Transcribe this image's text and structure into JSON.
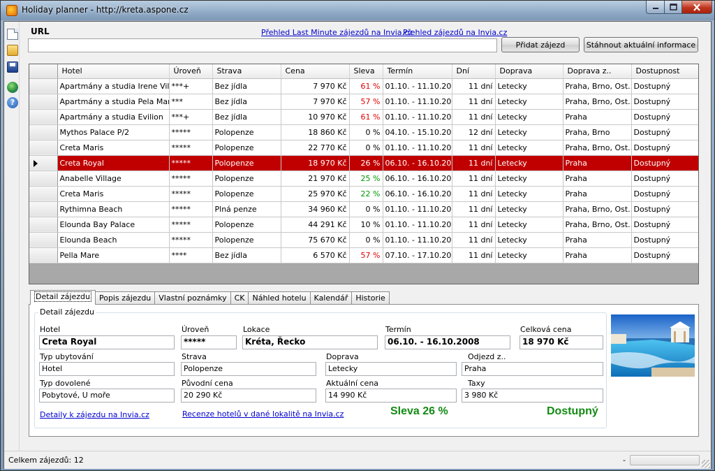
{
  "window": {
    "title": "Holiday planner - http://kreta.aspone.cz"
  },
  "url_section": {
    "label": "URL",
    "value": "",
    "link_last_minute": "Přehled Last Minute zájezdů na Invia.cz",
    "link_overview": "Přehled zájezdů na Invia.cz",
    "add_button": "Přidat zájezd",
    "download_button": "Stáhnout aktuální informace"
  },
  "grid": {
    "columns": [
      "Hotel",
      "Úroveň",
      "Strava",
      "Cena",
      "Sleva",
      "Termín",
      "Dní",
      "Doprava",
      "Doprava z..",
      "Dostupnost"
    ],
    "rows": [
      {
        "hotel": "Apartmány a studia Irene Village",
        "level": "***+",
        "board": "Bez jídla",
        "price": "7 970 Kč",
        "discount": "61 %",
        "discount_color": "red",
        "term": "01.10. - 11.10.20...",
        "days": "11 dní",
        "transport": "Letecky",
        "from": "Praha, Brno, Ost...",
        "availability": "Dostupný"
      },
      {
        "hotel": "Apartmány a studia Pela Mare",
        "level": "***",
        "board": "Bez jídla",
        "price": "7 970 Kč",
        "discount": "57 %",
        "discount_color": "red",
        "term": "01.10. - 11.10.20...",
        "days": "11 dní",
        "transport": "Letecky",
        "from": "Praha, Brno, Ost...",
        "availability": "Dostupný"
      },
      {
        "hotel": "Apartmány a studia Evilion",
        "level": "***+",
        "board": "Bez jídla",
        "price": "10 970 Kč",
        "discount": "61 %",
        "discount_color": "red",
        "term": "01.10. - 11.10.20...",
        "days": "11 dní",
        "transport": "Letecky",
        "from": "Praha",
        "availability": "Dostupný"
      },
      {
        "hotel": "Mythos Palace P/2",
        "level": "*****",
        "board": "Polopenze",
        "price": "18 860 Kč",
        "discount": "0 %",
        "discount_color": "black",
        "term": "04.10. - 15.10.20...",
        "days": "12 dní",
        "transport": "Letecky",
        "from": "Praha, Brno",
        "availability": "Dostupný"
      },
      {
        "hotel": "Creta Maris",
        "level": "*****",
        "board": "Polopenze",
        "price": "22 770 Kč",
        "discount": "0 %",
        "discount_color": "black",
        "term": "01.10. - 11.10.20...",
        "days": "11 dní",
        "transport": "Letecky",
        "from": "Praha, Brno, Ost...",
        "availability": "Dostupný"
      },
      {
        "hotel": "Creta Royal",
        "level": "*****",
        "board": "Polopenze",
        "price": "18 970 Kč",
        "discount": "26 %",
        "discount_color": "black",
        "term": "06.10. - 16.10.20...",
        "days": "11 dní",
        "transport": "Letecky",
        "from": "Praha",
        "availability": "Dostupný",
        "selected": true
      },
      {
        "hotel": "Anabelle Village",
        "level": "*****",
        "board": "Polopenze",
        "price": "21 970 Kč",
        "discount": "25 %",
        "discount_color": "green",
        "term": "06.10. - 16.10.20...",
        "days": "11 dní",
        "transport": "Letecky",
        "from": "Praha",
        "availability": "Dostupný"
      },
      {
        "hotel": "Creta Maris",
        "level": "*****",
        "board": "Polopenze",
        "price": "25 970 Kč",
        "discount": "22 %",
        "discount_color": "green",
        "term": "06.10. - 16.10.20...",
        "days": "11 dní",
        "transport": "Letecky",
        "from": "Praha",
        "availability": "Dostupný"
      },
      {
        "hotel": "Rythimna Beach",
        "level": "*****",
        "board": "Plná penze",
        "price": "34 960 Kč",
        "discount": "0 %",
        "discount_color": "black",
        "term": "01.10. - 11.10.20...",
        "days": "11 dní",
        "transport": "Letecky",
        "from": "Praha, Brno, Ost...",
        "availability": "Dostupný"
      },
      {
        "hotel": "Elounda Bay Palace",
        "level": "*****",
        "board": "Polopenze",
        "price": "44 291 Kč",
        "discount": "10 %",
        "discount_color": "black",
        "term": "01.10. - 11.10.20...",
        "days": "11 dní",
        "transport": "Letecky",
        "from": "Praha, Brno, Ost...",
        "availability": "Dostupný"
      },
      {
        "hotel": "Elounda Beach",
        "level": "*****",
        "board": "Polopenze",
        "price": "75 670 Kč",
        "discount": "0 %",
        "discount_color": "black",
        "term": "01.10. - 11.10.20...",
        "days": "11 dní",
        "transport": "Letecky",
        "from": "Praha",
        "availability": "Dostupný"
      },
      {
        "hotel": "Pella Mare",
        "level": "****",
        "board": "Bez jídla",
        "price": "6 570 Kč",
        "discount": "57 %",
        "discount_color": "red",
        "term": "07.10. - 17.10.20...",
        "days": "11 dní",
        "transport": "Letecky",
        "from": "Praha",
        "availability": "Dostupný"
      }
    ]
  },
  "tabs": [
    "Detail zájezdu",
    "Popis zájezdu",
    "Vlastní poznámky",
    "CK",
    "Náhled hotelu",
    "Kalendář",
    "Historie"
  ],
  "active_tab": 0,
  "detail": {
    "group_title": "Detail zájezdu",
    "hotel_label": "Hotel",
    "hotel_value": "Creta Royal",
    "level_label": "Úroveň",
    "level_value": "*****",
    "location_label": "Lokace",
    "location_value": "Kréta, Řecko",
    "term_label": "Termín",
    "term_value": "06.10. - 16.10.2008",
    "total_label": "Celková cena",
    "total_value": "18 970 Kč",
    "accommodation_label": "Typ ubytování",
    "accommodation_value": "Hotel",
    "board_label": "Strava",
    "board_value": "Polopenze",
    "transport_label": "Doprava",
    "transport_value": "Letecky",
    "departure_label": "Odjezd z..",
    "departure_value": "Praha",
    "vacation_type_label": "Typ dovolené",
    "vacation_type_value": "Pobytové, U moře",
    "original_price_label": "Původní cena",
    "original_price_value": "20 290 Kč",
    "current_price_label": "Aktuální cena",
    "current_price_value": "14 990 Kč",
    "taxes_label": "Taxy",
    "taxes_value": "3 980 Kč",
    "link_details": "Detaily k zájezdu na Invia.cz",
    "link_reviews": "Recenze hotelů v dané lokalitě na Invia.cz",
    "discount_text": "Sleva 26 %",
    "availability_text": "Dostupný"
  },
  "status": {
    "text": "Celkem zájezdů: 12",
    "dash": "-"
  },
  "colors": {
    "selection": "#c00000",
    "discount_red": "#e00000",
    "discount_green": "#009900",
    "accent_green": "#138a13",
    "link": "#0000cc"
  }
}
